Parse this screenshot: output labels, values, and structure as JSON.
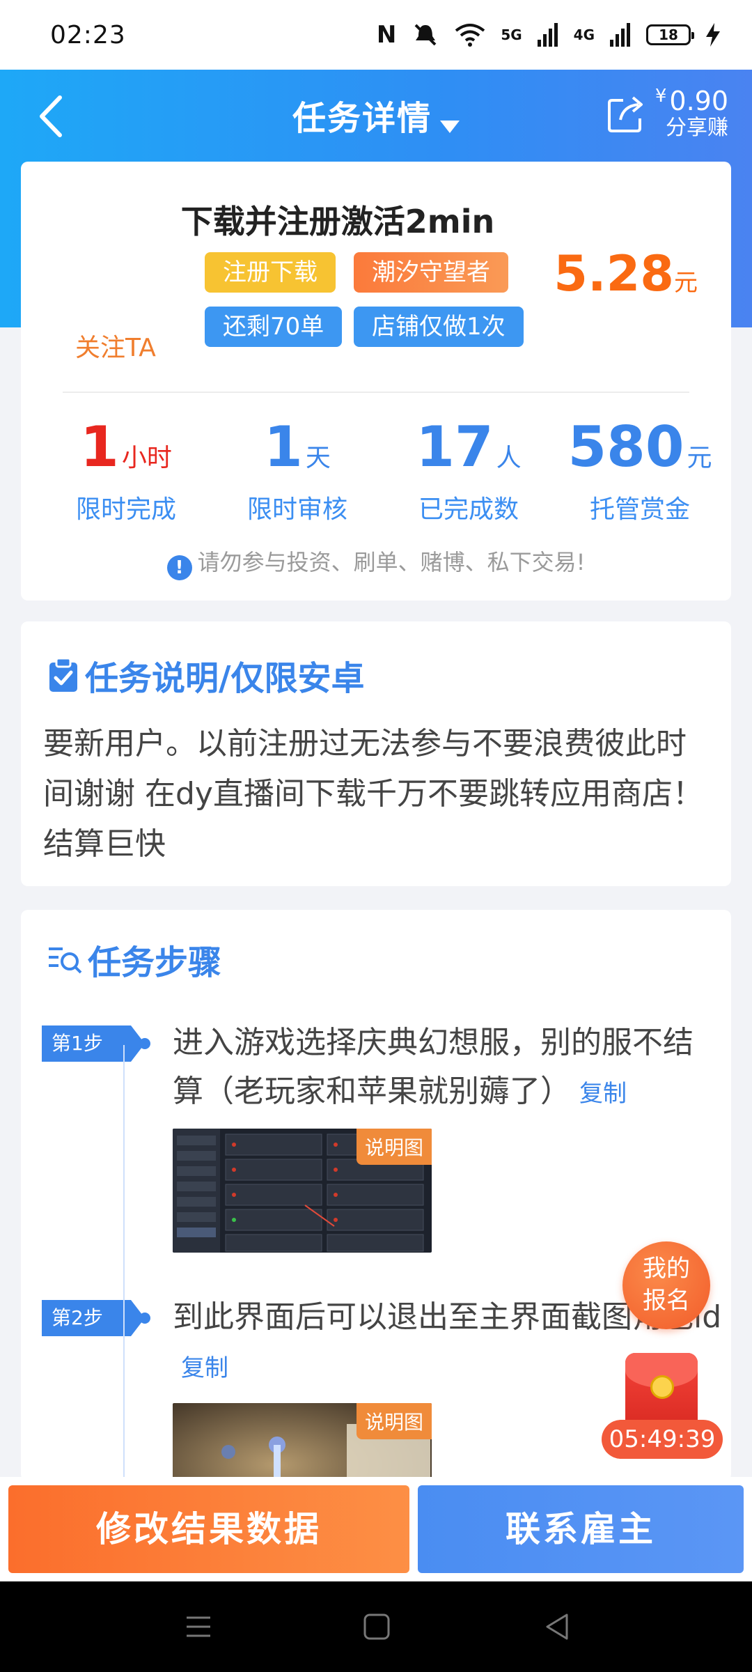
{
  "status_bar": {
    "time": "02:23",
    "battery": "18",
    "signal1": "5G",
    "signal2": "4G"
  },
  "header": {
    "title": "任务详情",
    "share_amount": "0.90",
    "share_currency": "¥",
    "share_label": "分享赚"
  },
  "task": {
    "title": "下载并注册激活2min",
    "tags": [
      "注册下载",
      "潮汐守望者",
      "还剩70单",
      "店铺仅做1次"
    ],
    "price": "5.28",
    "price_unit": "元",
    "follow": "关注TA",
    "stats": [
      {
        "value": "1",
        "unit": "小时",
        "label": "限时完成"
      },
      {
        "value": "1",
        "unit": "天",
        "label": "限时审核"
      },
      {
        "value": "17",
        "unit": "人",
        "label": "已完成数"
      },
      {
        "value": "580",
        "unit": "元",
        "label": "托管赏金"
      }
    ],
    "warning": "请勿参与投资、刷单、赌博、私下交易!"
  },
  "description": {
    "title": "任务说明/仅限安卓",
    "text": "要新用户。以前注册过无法参与不要浪费彼此时间谢谢 在dy直播间下载千万不要跳转应用商店！ 结算巨快"
  },
  "steps": {
    "title": "任务步骤",
    "items": [
      {
        "badge": "第1步",
        "text": "进入游戏选择庆典幻想服，别的服不结算（老玩家和苹果就别薅了）",
        "copy": "复制",
        "image_tag": "说明图"
      },
      {
        "badge": "第2步",
        "text": "到此界面后可以退出至主界面截图角色id",
        "copy": "复制",
        "image_tag": "说明图"
      }
    ]
  },
  "floating": {
    "signup": [
      "我的",
      "报名"
    ],
    "countdown": "05:49:39"
  },
  "bottom": {
    "left_button": "修改结果数据",
    "right_button": "联系雇主"
  },
  "colors": {
    "primary": "#3a85ea",
    "accent_orange": "#fa6a12",
    "header_gradient_start": "#1ea8f7",
    "header_gradient_end": "#4a83f1"
  }
}
